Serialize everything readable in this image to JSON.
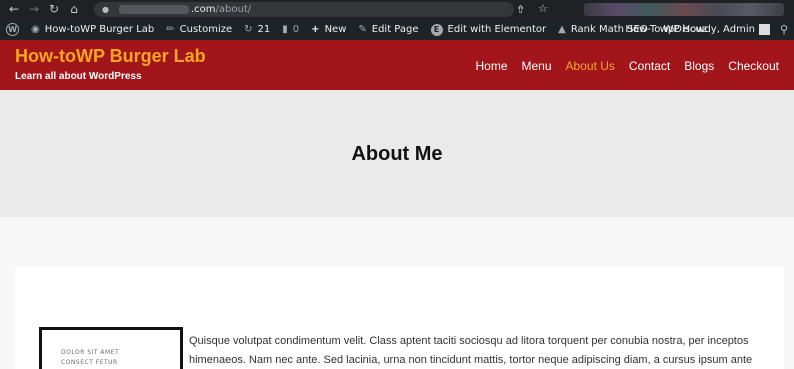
{
  "browser": {
    "url_domain": ".com",
    "url_path": "/about/"
  },
  "adminbar": {
    "site_name": "How-toWP Burger Lab",
    "customize": "Customize",
    "updates_count": "21",
    "comments_count": "0",
    "new": "New",
    "edit_page": "Edit Page",
    "edit_elementor": "Edit with Elementor",
    "rank_math": "Rank Math SEO",
    "wpdiscuz": "wpDiscuz",
    "howdy": "How-To WP Howdy, Admin"
  },
  "header": {
    "site_title": "How-toWP Burger Lab",
    "tagline": "Learn all about WordPress",
    "nav": [
      "Home",
      "Menu",
      "About Us",
      "Contact",
      "Blogs",
      "Checkout"
    ],
    "active_nav": "About Us"
  },
  "page": {
    "title": "About Me"
  },
  "content": {
    "quote_line1": "DOLOR SIT AMET",
    "quote_line2": "CONSECT FETUR",
    "paragraph": "Quisque volutpat condimentum velit. Class aptent taciti sociosqu ad litora torquent per conubia nostra, per inceptos himenaeos. Nam nec ante. Sed lacinia, urna non tincidunt mattis, tortor neque adipiscing diam, a cursus ipsum ante"
  },
  "colors": {
    "header_bg": "#a2151a",
    "accent": "#f5a623",
    "adminbar_bg": "#1d2327",
    "browser_bg": "#202124"
  }
}
